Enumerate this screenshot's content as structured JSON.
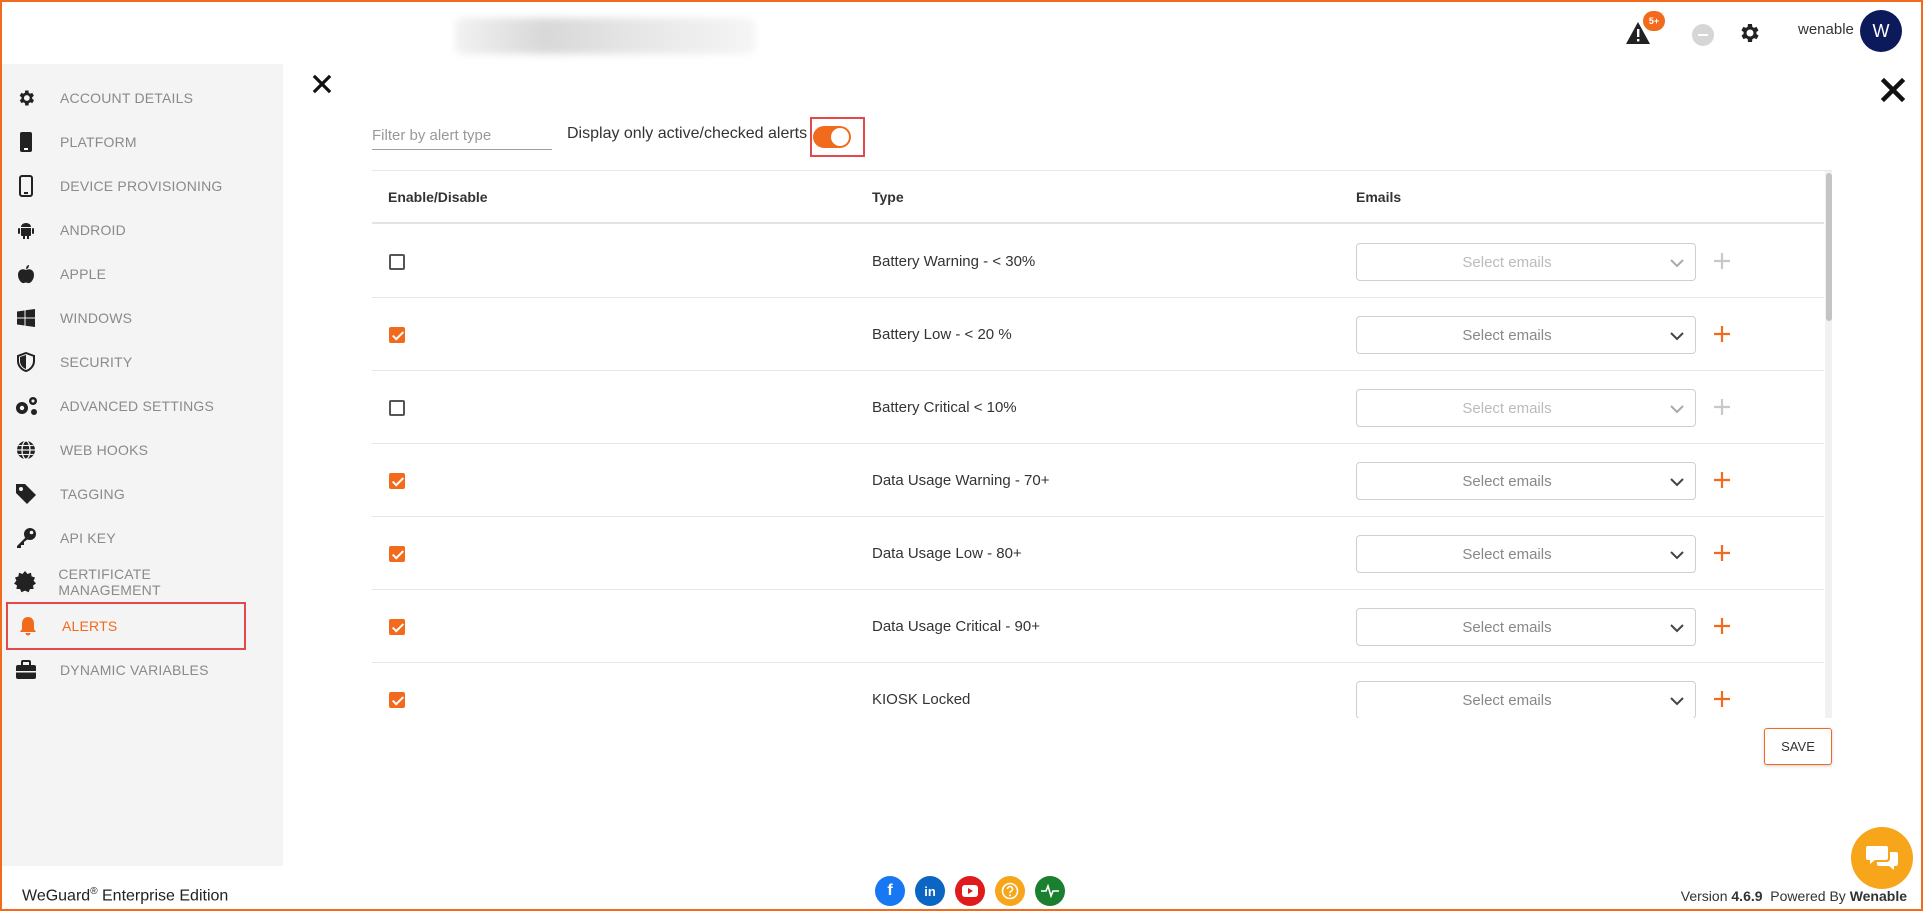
{
  "header": {
    "alert_badge": "5+",
    "username": "wenable",
    "avatar_initial": "W"
  },
  "sidebar": {
    "items": [
      {
        "label": "ACCOUNT DETAILS",
        "icon": "gear-icon"
      },
      {
        "label": "PLATFORM",
        "icon": "phone-icon"
      },
      {
        "label": "DEVICE PROVISIONING",
        "icon": "mobile-icon"
      },
      {
        "label": "ANDROID",
        "icon": "android-icon"
      },
      {
        "label": "APPLE",
        "icon": "apple-icon"
      },
      {
        "label": "WINDOWS",
        "icon": "windows-icon"
      },
      {
        "label": "SECURITY",
        "icon": "shield-icon"
      },
      {
        "label": "ADVANCED SETTINGS",
        "icon": "gears-icon"
      },
      {
        "label": "WEB HOOKS",
        "icon": "globe-icon"
      },
      {
        "label": "TAGGING",
        "icon": "tag-icon"
      },
      {
        "label": "API KEY",
        "icon": "key-icon"
      },
      {
        "label": "CERTIFICATE MANAGEMENT",
        "icon": "certificate-icon"
      },
      {
        "label": "ALERTS",
        "icon": "bell-icon",
        "active": true
      },
      {
        "label": "DYNAMIC VARIABLES",
        "icon": "briefcase-icon"
      }
    ]
  },
  "filter": {
    "placeholder": "Filter by alert type"
  },
  "toggle": {
    "label": "Display only active/checked alerts",
    "on": true
  },
  "table": {
    "columns": [
      "Enable/Disable",
      "Type",
      "Emails"
    ],
    "rows": [
      {
        "checked": false,
        "type": "Battery Warning - < 30%",
        "emails_placeholder": "Select emails"
      },
      {
        "checked": true,
        "type": "Battery Low - < 20 %",
        "emails_placeholder": "Select emails"
      },
      {
        "checked": false,
        "type": "Battery Critical < 10%",
        "emails_placeholder": "Select emails"
      },
      {
        "checked": true,
        "type": "Data Usage Warning - 70+",
        "emails_placeholder": "Select emails"
      },
      {
        "checked": true,
        "type": "Data Usage Low - 80+",
        "emails_placeholder": "Select emails"
      },
      {
        "checked": true,
        "type": "Data Usage Critical - 90+",
        "emails_placeholder": "Select emails"
      },
      {
        "checked": true,
        "type": "KIOSK Locked",
        "emails_placeholder": "Select emails"
      }
    ]
  },
  "save_label": "SAVE",
  "footer": {
    "brand": "WeGuard",
    "brand_sup": "®",
    "brand_suffix": " Enterprise Edition",
    "version_prefix": "Version ",
    "version": "4.6.9",
    "powered_prefix": "  Powered By ",
    "powered_by": "Wenable"
  },
  "colors": {
    "accent": "#f26b1d",
    "highlight_border": "#e2494a",
    "avatar_bg": "#0c1a5c",
    "chat": "#f7a51b"
  }
}
